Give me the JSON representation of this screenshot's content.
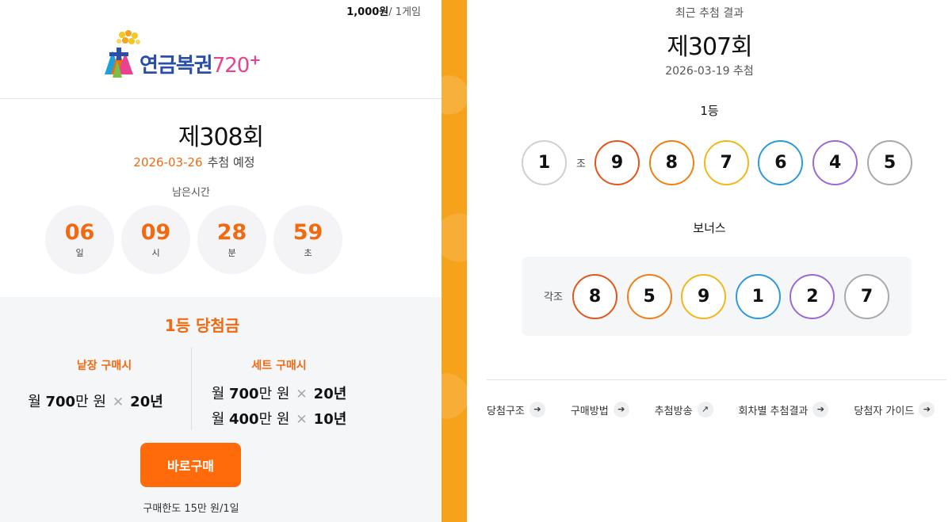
{
  "header": {
    "price": "1,000원",
    "per_game": "/ 1게임"
  },
  "logo": {
    "text_main": "연금복권",
    "text_num": "720",
    "plus": "+"
  },
  "upcoming": {
    "round": "제308회",
    "date": "2026-03-26",
    "date_suffix": "추첨 예정",
    "remain_label": "남은시간",
    "countdown": [
      {
        "value": "06",
        "unit": "일"
      },
      {
        "value": "09",
        "unit": "시"
      },
      {
        "value": "28",
        "unit": "분"
      },
      {
        "value": "59",
        "unit": "초"
      }
    ]
  },
  "prize": {
    "title": "1등 당첨금",
    "single": {
      "head": "낱장 구매시",
      "rows": [
        {
          "pre": "월 ",
          "amount": "700",
          "post": "만 원",
          "x": "✕",
          "years": "20년"
        }
      ]
    },
    "set": {
      "head": "세트 구매시",
      "rows": [
        {
          "pre": "월 ",
          "amount": "700",
          "post": "만 원",
          "x": "✕",
          "years": "20년"
        },
        {
          "pre": "월 ",
          "amount": "400",
          "post": "만 원",
          "x": "✕",
          "years": "10년"
        }
      ]
    },
    "buy_button": "바로구매",
    "limit": "구매한도 15만 원/1일"
  },
  "recent": {
    "subtitle": "최근 추첨 결과",
    "round": "제307회",
    "date": "2026-03-19 추첨",
    "first_label": "1등",
    "first": {
      "group": "1",
      "group_label": "조",
      "numbers": [
        "9",
        "8",
        "7",
        "6",
        "4",
        "5"
      ]
    },
    "bonus_label": "보너스",
    "bonus": {
      "group_label": "각조",
      "numbers": [
        "8",
        "5",
        "9",
        "1",
        "2",
        "7"
      ]
    }
  },
  "ball_colors": [
    "#e0561c",
    "#f07f16",
    "#f0b818",
    "#2f9bd6",
    "#9a6ad6",
    "#a9a9b0"
  ],
  "group_ball_color": "#cfcfd4",
  "accent_color": "#ff6b0a",
  "links": [
    {
      "label": "당첨구조",
      "icon": "arrow-right-icon",
      "glyph": "➔"
    },
    {
      "label": "구매방법",
      "icon": "arrow-right-icon",
      "glyph": "➔"
    },
    {
      "label": "추첨방송",
      "icon": "arrow-up-right-icon",
      "glyph": "↗"
    },
    {
      "label": "회차별 추첨결과",
      "icon": "arrow-right-icon",
      "glyph": "➔"
    },
    {
      "label": "당첨자 가이드",
      "icon": "arrow-right-icon",
      "glyph": "➔"
    }
  ]
}
